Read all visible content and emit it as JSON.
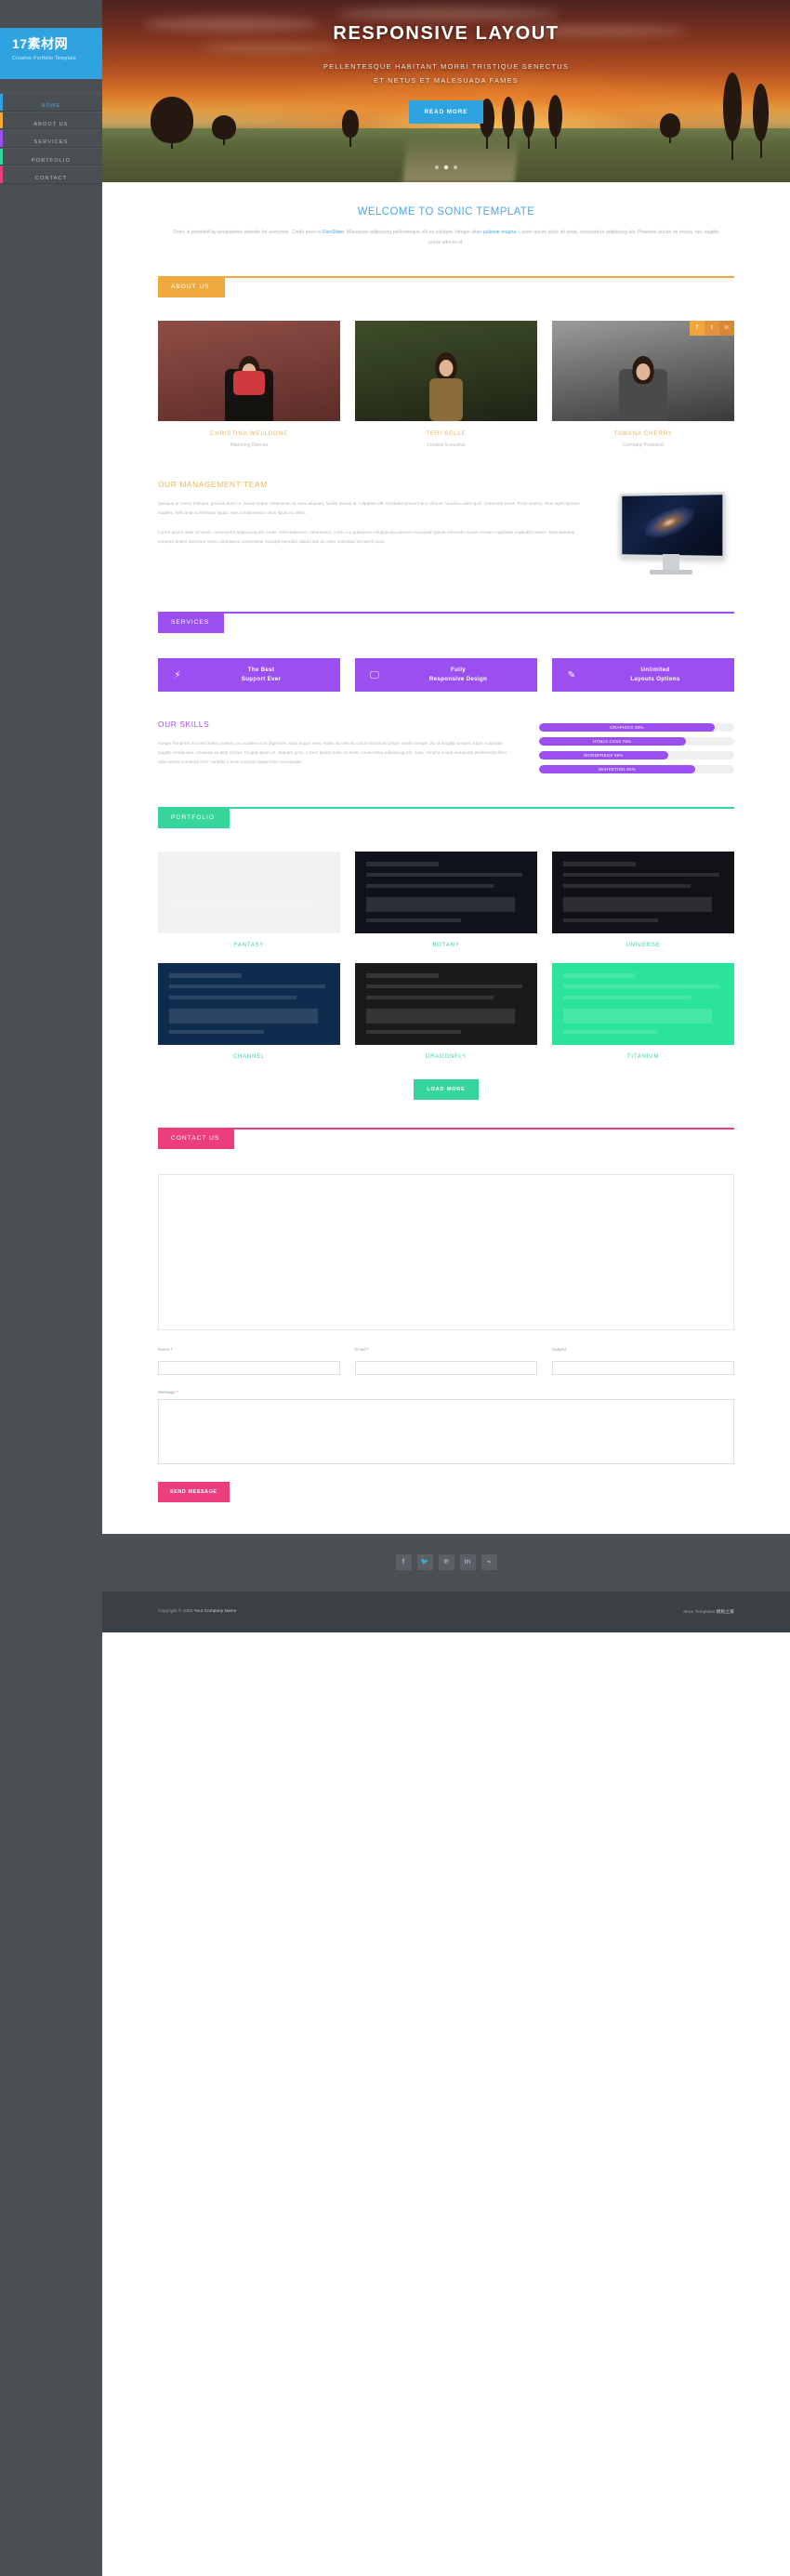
{
  "sidebar": {
    "logo_title": "17素材网",
    "logo_subtitle": "Creative Portfolio Template",
    "logo_bg": "#2fa3e0",
    "items": [
      {
        "label": "HOME",
        "color": "#2fa3e0",
        "active": true
      },
      {
        "label": "ABOUT US",
        "color": "#efa93c",
        "active": false
      },
      {
        "label": "SERVICES",
        "color": "#9b4ff0",
        "active": false
      },
      {
        "label": "PORTFOLIO",
        "color": "#36d69a",
        "active": false
      },
      {
        "label": "CONTACT",
        "color": "#ec3e7c",
        "active": false
      }
    ]
  },
  "hero": {
    "title": "RESPONSIVE LAYOUT",
    "subtitle_line1": "PELLENTESQUE HABITANT MORBI TRISTIQUE SENECTUS",
    "subtitle_line2": "ET NETUS ET MALESUADA FAMES",
    "button_label": "READ MORE",
    "slides": 3,
    "active_slide": 1
  },
  "welcome": {
    "heading": "WELCOME TO SONIC TEMPLATE",
    "text_before_link1": "Sonic is provided by templatemo website for everyone. Credit goes to ",
    "link1": "FlexSlider",
    "text_between": ". Maecenas adipiscing pellentesque elit eu volutpat. Integer vitae ",
    "link2": "pulvinar magna",
    "text_after": ". Lorem ipsum dolor sit amet, consectetur adipiscing elit. Praesent auctor mi metus, nec sagittis purus ultrices id."
  },
  "about": {
    "tab_label": "ABOUT US",
    "accent": "#efa93c",
    "team": [
      {
        "name": "CHRISTINA WELLDONE",
        "role": "Marketing Director"
      },
      {
        "name": "TERI BELLE",
        "role": "Creative Executive"
      },
      {
        "name": "TAWANA CHERRY",
        "role": "Company President"
      }
    ],
    "social_icons": [
      "f",
      "t",
      "in"
    ],
    "management": {
      "heading": "OUR MANAGEMENT TEAM",
      "paragraph1": "Quisque in metus tristique, gravida dolor ut, varius neque. Maecenas ac risus aliquam, facilisi massa id, vulputate elit. Curabitur pretium arcu dictum, faucibus diam quis, commodo turpis. Proin viverra, risus eget egestas sodales, felis ante scelerisque ligula, eget condimentum diam ligula eu tellus.",
      "paragraph2": "Lorem ipsum dolor sit amet, consectetur adipisicing elit. Unde, exercitationem, laboriosam, modi non quisquam voluptas accusamus numquam ipsum reiciendis saepe veniam cupiditate explicabo autem. Repudiandae tempore dolore deserunt nemo voluptatum consectetur suscipit expedita aliquid iste do enim molestias vel animi quisi."
    }
  },
  "services": {
    "tab_label": "SERVICES",
    "accent": "#9b4ff0",
    "boxes": [
      {
        "icon": "bolt-icon",
        "glyph": "⚡",
        "line1": "The Best",
        "line2": "Support Ever"
      },
      {
        "icon": "monitor-icon",
        "glyph": "🖵",
        "line1": "Fully",
        "line2": "Responsive Design"
      },
      {
        "icon": "pencil-icon",
        "glyph": "✎",
        "line1": "Unlimited",
        "line2": "Layouts Options"
      }
    ],
    "skills": {
      "heading": "OUR SKILLS",
      "paragraph": "Integer hendrerit erat sed tellus pretium, eu sodales eros dignissim. Duis augue eros, mollis ac velit at, rutrum tincidunt ipsum. Morbi semper dui id fringilla semper. Etiam vulputate sagittis vestibulum. Vivamus ac ante cursus, feugiat ipsum et, aliquam justo. Lorem ipsum dolor sit amet, consectetur adipisicing elit. Iusto, minima soluta numquam perferendis illum alias omnis commodi error veritatis a esse nostrum asperiores recusandae.",
      "bars": [
        {
          "label": "GRAPHICS 90%",
          "value": 90
        },
        {
          "label": "HTML5 CSS3 75%",
          "value": 75
        },
        {
          "label": "WORDPRESS 66%",
          "value": 66
        },
        {
          "label": "MARKETING 80%",
          "value": 80
        }
      ]
    }
  },
  "portfolio": {
    "tab_label": "PORTFOLIO",
    "accent": "#36d69a",
    "items": [
      {
        "caption": "FANTASY",
        "theme": "th-fantasy"
      },
      {
        "caption": "BOTANY",
        "theme": "th-botany"
      },
      {
        "caption": "UNIVERSE",
        "theme": "th-universe"
      },
      {
        "caption": "CHANNEL",
        "theme": "th-channel"
      },
      {
        "caption": "DRAGONFLY",
        "theme": "th-dragon"
      },
      {
        "caption": "TITANIUM",
        "theme": "th-titanium"
      }
    ],
    "load_more_label": "LOAD MORE"
  },
  "contact": {
    "tab_label": "CONTACT US",
    "accent": "#ec3e7c",
    "fields": [
      {
        "label": "Name",
        "required": true,
        "value": "",
        "placeholder": ""
      },
      {
        "label": "Email",
        "required": true,
        "value": "",
        "placeholder": ""
      },
      {
        "label": "Subject",
        "required": false,
        "value": "",
        "placeholder": ""
      }
    ],
    "message_label": "Message",
    "message_required": true,
    "message_value": "",
    "submit_label": "SEND MESSAGE"
  },
  "footer": {
    "social": [
      {
        "name": "facebook-icon",
        "glyph": "f"
      },
      {
        "name": "twitter-icon",
        "glyph": "🐦"
      },
      {
        "name": "pinterest-icon",
        "glyph": "℗"
      },
      {
        "name": "linkedin-icon",
        "glyph": "in"
      },
      {
        "name": "rss-icon",
        "glyph": "⌁"
      }
    ],
    "copyright_prefix": "Copyright © 2084 ",
    "copyright_company": "Your Company Name",
    "credit_prefix": "More Templates ",
    "credit_name": "模板之家"
  }
}
